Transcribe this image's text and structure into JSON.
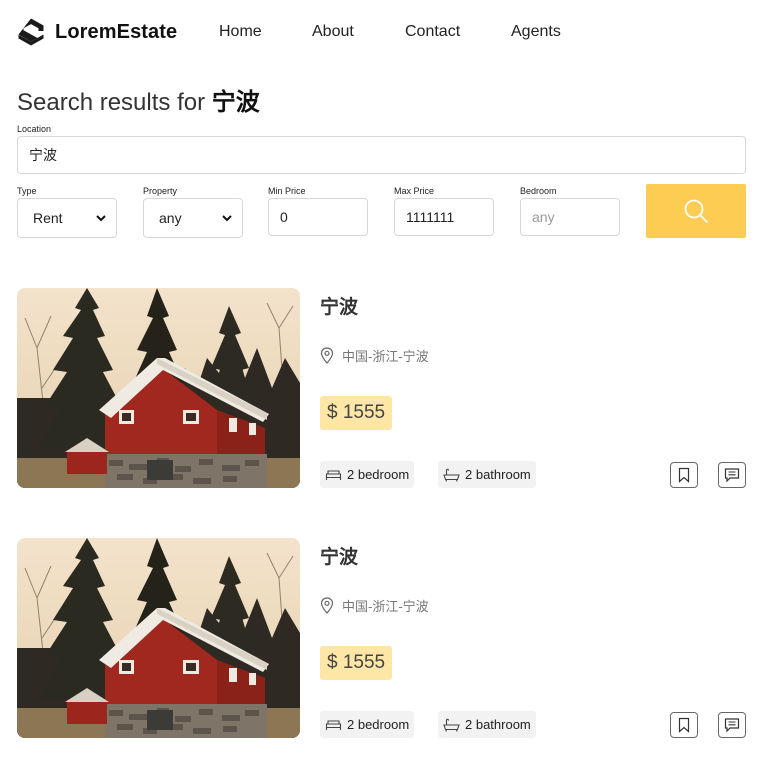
{
  "brand": {
    "name": "LoremEstate",
    "logo_icon": "hexagon-s-logo-icon"
  },
  "nav": {
    "items": [
      "Home",
      "About",
      "Contact",
      "Agents"
    ]
  },
  "search": {
    "title_prefix": "Search results for ",
    "title_query": "宁波",
    "location": {
      "label": "Location",
      "value": "宁波"
    },
    "type": {
      "label": "Type",
      "selected": "Rent"
    },
    "property": {
      "label": "Property",
      "selected": "any"
    },
    "min_price": {
      "label": "Min Price",
      "value": "0"
    },
    "max_price": {
      "label": "Max Price",
      "value": "1111111"
    },
    "bedroom": {
      "label": "Bedroom",
      "placeholder": "any"
    },
    "button_icon": "search-icon",
    "accent_color": "#fdcc52"
  },
  "listings": [
    {
      "title": "宁波",
      "location": "中国-浙江-宁波",
      "price": "$ 1555",
      "bedrooms": "2 bedroom",
      "bathrooms": "2 bathroom",
      "photo": "red-house-photo"
    },
    {
      "title": "宁波",
      "location": "中国-浙江-宁波",
      "price": "$ 1555",
      "bedrooms": "2 bedroom",
      "bathrooms": "2 bathroom",
      "photo": "red-house-photo"
    }
  ],
  "colors": {
    "price_badge": "#fde6a6",
    "feature_bg": "#f2f2f2"
  }
}
